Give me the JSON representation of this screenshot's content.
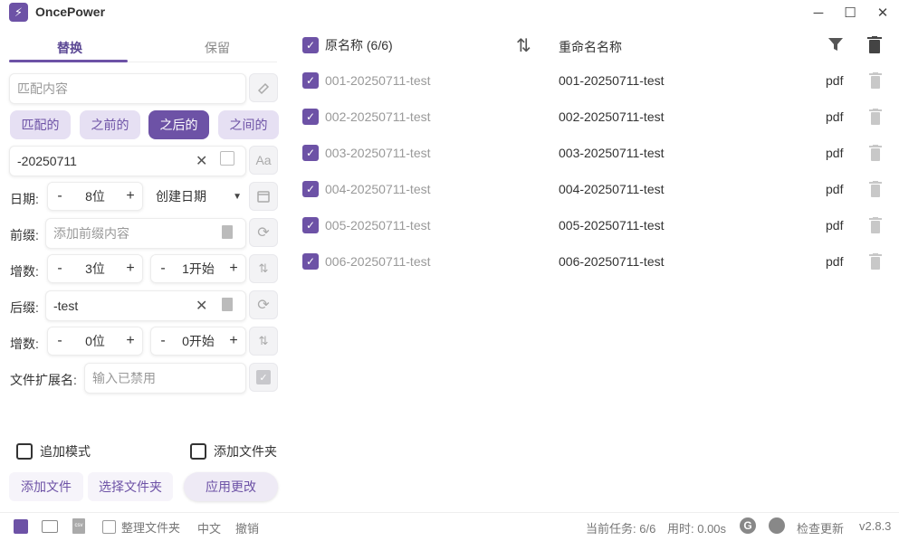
{
  "app": {
    "title": "OncePower",
    "version": "v2.8.3"
  },
  "tabs": [
    {
      "label": "替换"
    },
    {
      "label": "保留"
    }
  ],
  "match": {
    "placeholder": "匹配内容"
  },
  "modes": [
    {
      "label": "匹配的"
    },
    {
      "label": "之前的"
    },
    {
      "label": "之后的"
    },
    {
      "label": "之间的"
    }
  ],
  "replace": {
    "value": "-20250711"
  },
  "date": {
    "label": "日期:",
    "digits": "8位",
    "type": "创建日期"
  },
  "prefix": {
    "label": "前缀:",
    "placeholder": "添加前缀内容"
  },
  "increment1": {
    "label": "增数:",
    "digits": "3位",
    "start": "1开始"
  },
  "suffix": {
    "label": "后缀:",
    "value": "-test"
  },
  "increment2": {
    "label": "增数:",
    "digits": "0位",
    "start": "0开始"
  },
  "extension": {
    "label": "文件扩展名:",
    "placeholder": "输入已禁用"
  },
  "options": {
    "append_mode": "追加模式",
    "add_folder": "添加文件夹"
  },
  "actions": {
    "add_files": "添加文件",
    "select_folder": "选择文件夹",
    "apply": "应用更改"
  },
  "table": {
    "orig_header": "原名称 (6/6)",
    "new_header": "重命名名称",
    "rows": [
      {
        "orig": "001-20250711-test",
        "new": "001-20250711-test",
        "ext": "pdf"
      },
      {
        "orig": "002-20250711-test",
        "new": "002-20250711-test",
        "ext": "pdf"
      },
      {
        "orig": "003-20250711-test",
        "new": "003-20250711-test",
        "ext": "pdf"
      },
      {
        "orig": "004-20250711-test",
        "new": "004-20250711-test",
        "ext": "pdf"
      },
      {
        "orig": "005-20250711-test",
        "new": "005-20250711-test",
        "ext": "pdf"
      },
      {
        "orig": "006-20250711-test",
        "new": "006-20250711-test",
        "ext": "pdf"
      }
    ]
  },
  "statusbar": {
    "organize": "整理文件夹",
    "language": "中文",
    "undo": "撤销",
    "task": "当前任务: 6/6",
    "time": "用时: 0.00s",
    "check_update": "检查更新"
  },
  "colors": {
    "accent": "#6d52a6",
    "accent_light": "#e6e0f3"
  }
}
